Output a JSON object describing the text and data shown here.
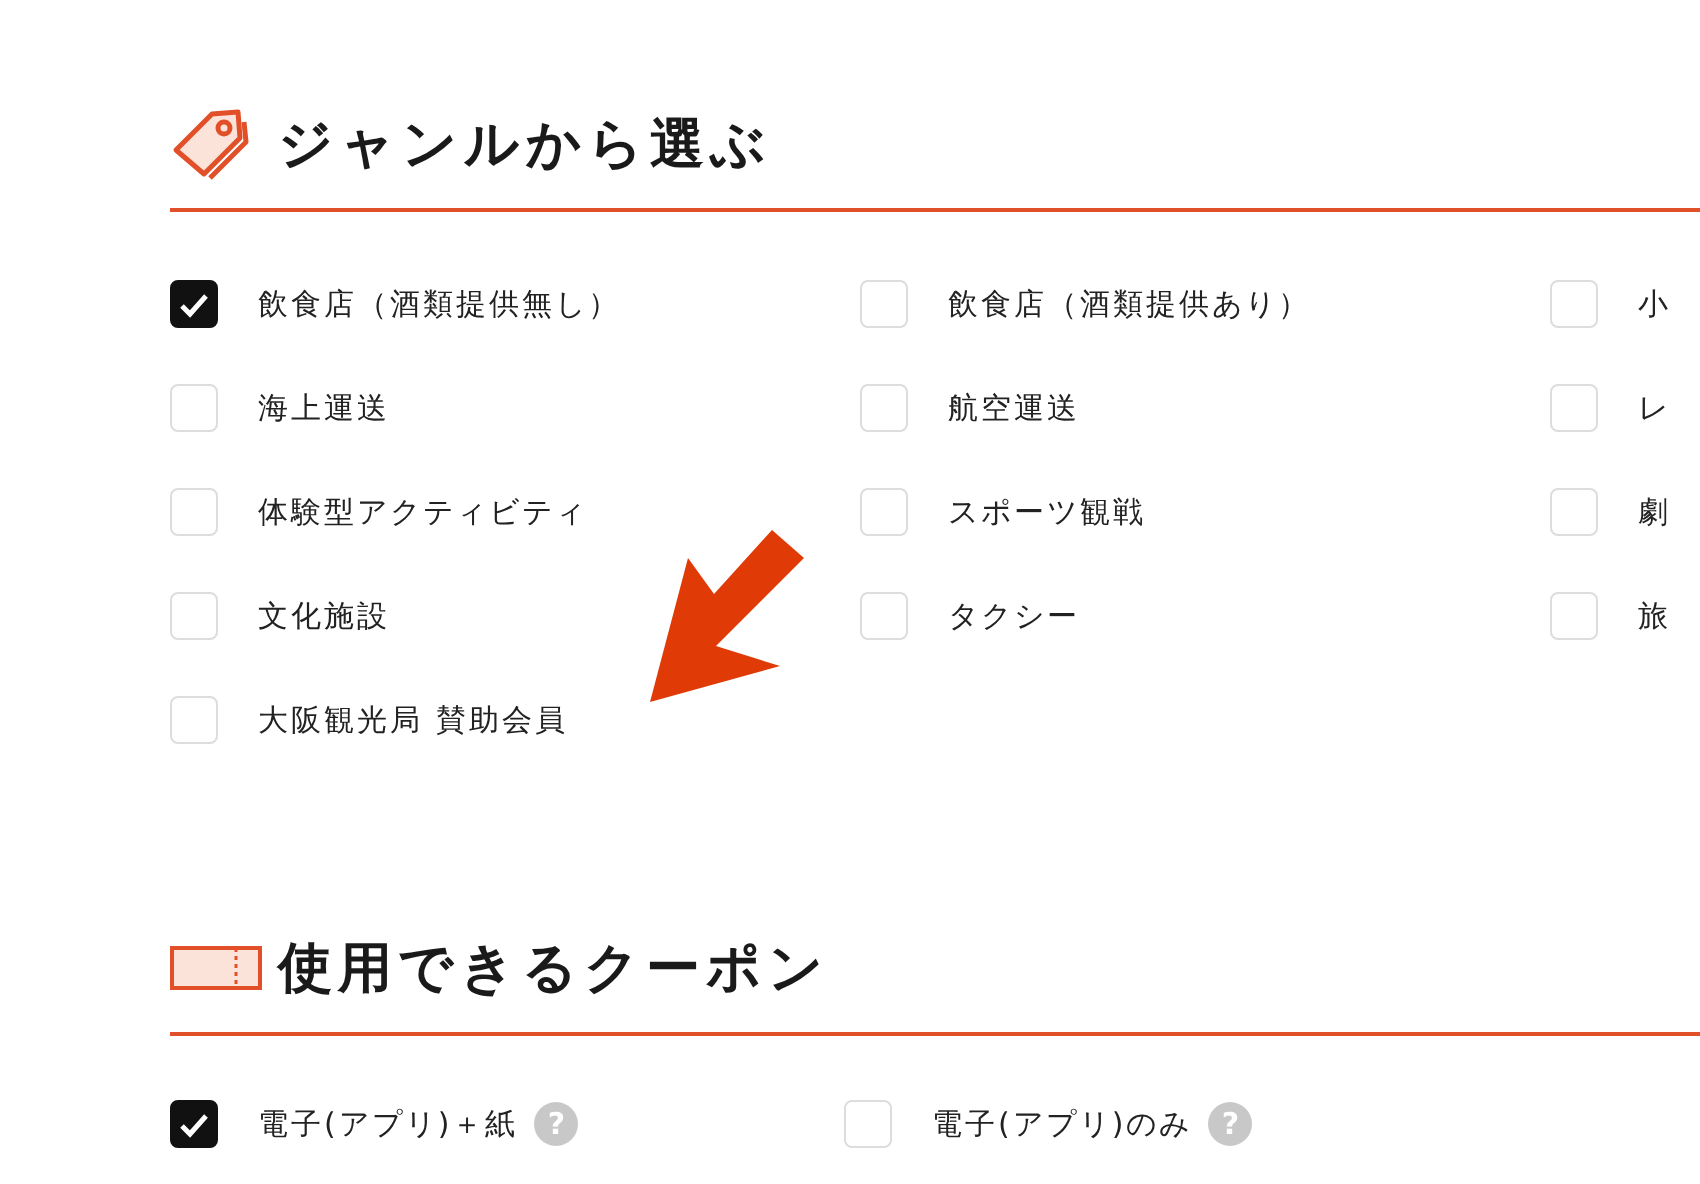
{
  "genre_section": {
    "title": "ジャンルから選ぶ",
    "options": [
      {
        "label": "飲食店（酒類提供無し）",
        "checked": true
      },
      {
        "label": "飲食店（酒類提供あり）",
        "checked": false
      },
      {
        "label": "小",
        "checked": false
      },
      {
        "label": "海上運送",
        "checked": false
      },
      {
        "label": "航空運送",
        "checked": false
      },
      {
        "label": "レ",
        "checked": false
      },
      {
        "label": "体験型アクティビティ",
        "checked": false
      },
      {
        "label": "スポーツ観戦",
        "checked": false
      },
      {
        "label": "劇",
        "checked": false
      },
      {
        "label": "文化施設",
        "checked": false
      },
      {
        "label": "タクシー",
        "checked": false
      },
      {
        "label": "旅",
        "checked": false
      },
      {
        "label": "大阪観光局 賛助会員",
        "checked": false
      }
    ]
  },
  "coupon_section": {
    "title": "使用できるクーポン",
    "options": [
      {
        "label": "電子(アプリ)＋紙",
        "checked": true,
        "help": "?"
      },
      {
        "label": "電子(アプリ)のみ",
        "checked": false,
        "help": "?"
      }
    ]
  }
}
